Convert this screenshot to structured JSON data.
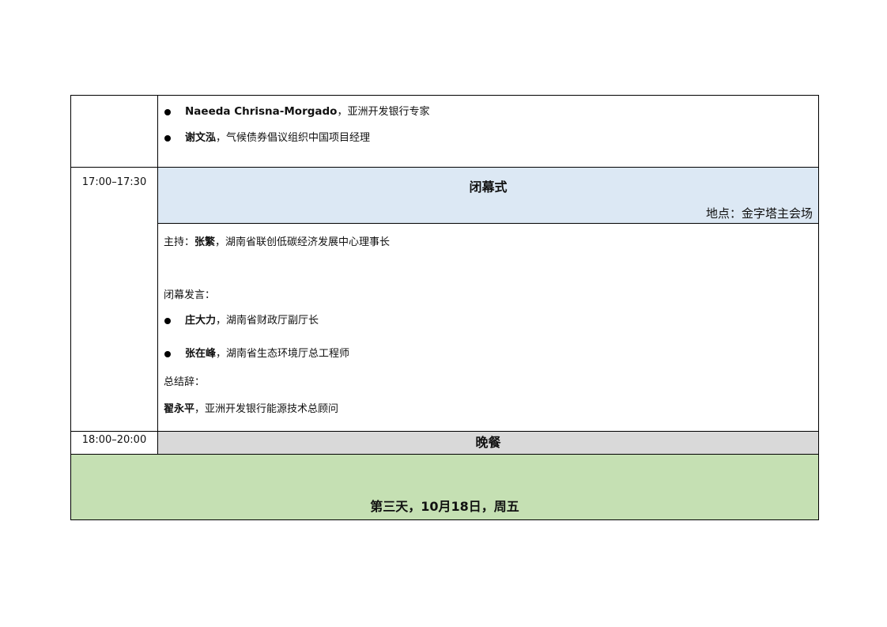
{
  "continuation": {
    "bullets": [
      {
        "name": "Naeeda Chrisna-Morgado",
        "separator": "，",
        "title": "亚洲开发银行专家"
      },
      {
        "name": "谢文泓",
        "separator": "，",
        "title": "气候债券倡议组织中国项目经理"
      }
    ]
  },
  "closing": {
    "time": "17:00–17:30",
    "title": "闭幕式",
    "venue": "地点：金字塔主会场",
    "host_label": "主持：",
    "host_name": "张繁",
    "host_title": "，湖南省联创低碳经济发展中心理事长",
    "speech_label": "闭幕发言：",
    "speakers": [
      {
        "name": "庄大力",
        "title": "，湖南省财政厅副厅长"
      },
      {
        "name": "张在峰",
        "title": "，湖南省生态环境厅总工程师"
      }
    ],
    "summary_label": "总结辞：",
    "summary_name": "翟永平",
    "summary_title": "，亚洲开发银行能源技术总顾问"
  },
  "dinner": {
    "time": "18:00–20:00",
    "title": "晚餐"
  },
  "day_header": {
    "title": "第三天，10月18日，周五"
  },
  "colors": {
    "ceremony_bg": "#dce8f4",
    "dinner_bg": "#d9d9d9",
    "day_bg": "#c5e0b3"
  }
}
